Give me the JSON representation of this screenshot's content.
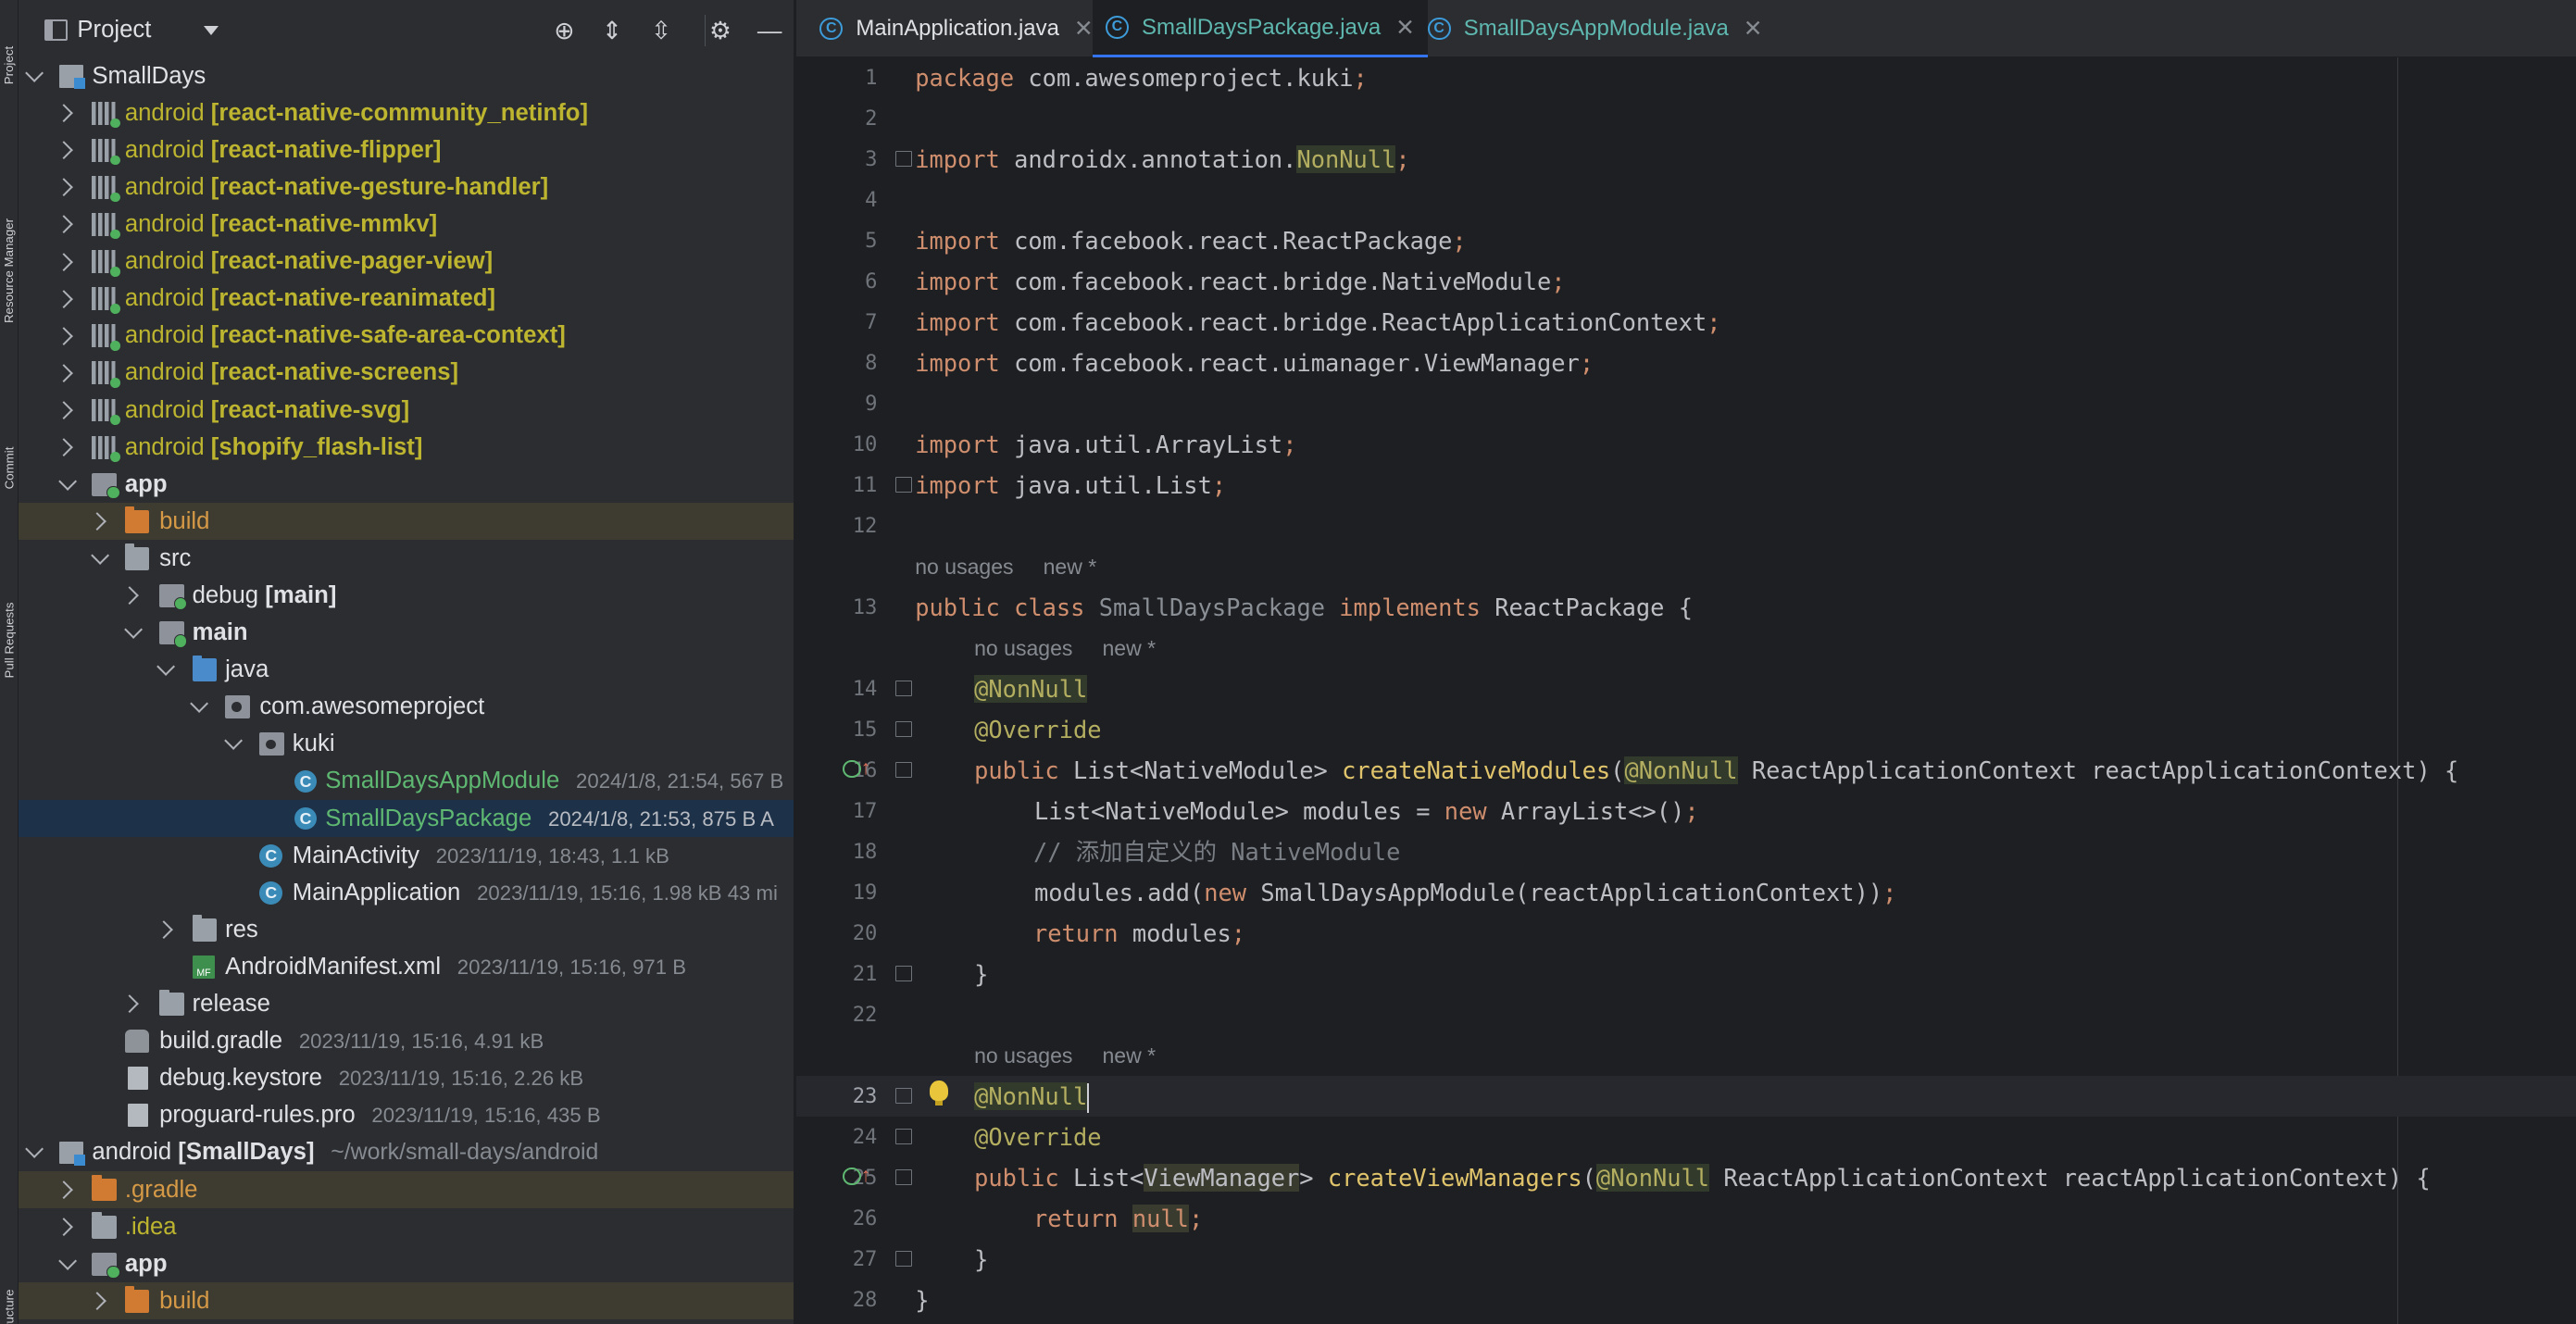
{
  "colors": {
    "accent": "#3574f0",
    "background": "#1e1f22",
    "panel": "#2b2d30",
    "keyword": "#cf8e6d",
    "annotation": "#b3ae60",
    "function": "#56a8f5"
  },
  "side_stripe": [
    "Project",
    "Resource Manager",
    "Commit",
    "Pull Requests",
    "Structure"
  ],
  "project_panel": {
    "title": "Project",
    "toolbar_icons": [
      "locate-icon",
      "expand-all-icon",
      "collapse-all-icon",
      "gear-icon",
      "minimize-icon"
    ]
  },
  "tree": [
    {
      "label": "SmallDays",
      "bracket": "",
      "meta": ""
    },
    {
      "label": "android",
      "bracket": "[react-native-community_netinfo]",
      "meta": ""
    },
    {
      "label": "android",
      "bracket": "[react-native-flipper]",
      "meta": ""
    },
    {
      "label": "android",
      "bracket": "[react-native-gesture-handler]",
      "meta": ""
    },
    {
      "label": "android",
      "bracket": "[react-native-mmkv]",
      "meta": ""
    },
    {
      "label": "android",
      "bracket": "[react-native-pager-view]",
      "meta": ""
    },
    {
      "label": "android",
      "bracket": "[react-native-reanimated]",
      "meta": ""
    },
    {
      "label": "android",
      "bracket": "[react-native-safe-area-context]",
      "meta": ""
    },
    {
      "label": "android",
      "bracket": "[react-native-screens]",
      "meta": ""
    },
    {
      "label": "android",
      "bracket": "[react-native-svg]",
      "meta": ""
    },
    {
      "label": "android",
      "bracket": "[shopify_flash-list]",
      "meta": ""
    },
    {
      "label": "app",
      "bracket": "",
      "meta": ""
    },
    {
      "label": "build",
      "bracket": "",
      "meta": ""
    },
    {
      "label": "src",
      "bracket": "",
      "meta": ""
    },
    {
      "label": "debug",
      "bracket": "[main]",
      "meta": ""
    },
    {
      "label": "main",
      "bracket": "",
      "meta": ""
    },
    {
      "label": "java",
      "bracket": "",
      "meta": ""
    },
    {
      "label": "com.awesomeproject",
      "bracket": "",
      "meta": ""
    },
    {
      "label": "kuki",
      "bracket": "",
      "meta": ""
    },
    {
      "label": "SmallDaysAppModule",
      "bracket": "",
      "meta": "2024/1/8, 21:54, 567 B"
    },
    {
      "label": "SmallDaysPackage",
      "bracket": "",
      "meta": "2024/1/8, 21:53, 875 B A"
    },
    {
      "label": "MainActivity",
      "bracket": "",
      "meta": "2023/11/19, 18:43, 1.1 kB"
    },
    {
      "label": "MainApplication",
      "bracket": "",
      "meta": "2023/11/19, 15:16, 1.98 kB 43 mi"
    },
    {
      "label": "res",
      "bracket": "",
      "meta": ""
    },
    {
      "label": "AndroidManifest.xml",
      "bracket": "",
      "meta": "2023/11/19, 15:16, 971 B"
    },
    {
      "label": "release",
      "bracket": "",
      "meta": ""
    },
    {
      "label": "build.gradle",
      "bracket": "",
      "meta": "2023/11/19, 15:16, 4.91 kB"
    },
    {
      "label": "debug.keystore",
      "bracket": "",
      "meta": "2023/11/19, 15:16, 2.26 kB"
    },
    {
      "label": "proguard-rules.pro",
      "bracket": "",
      "meta": "2023/11/19, 15:16, 435 B"
    },
    {
      "label": "android",
      "bracket": "[SmallDays]",
      "meta": "~/work/small-days/android"
    },
    {
      "label": ".gradle",
      "bracket": "",
      "meta": ""
    },
    {
      "label": ".idea",
      "bracket": "",
      "meta": ""
    },
    {
      "label": "app",
      "bracket": "",
      "meta": ""
    },
    {
      "label": "build",
      "bracket": "",
      "meta": ""
    }
  ],
  "tabs": [
    {
      "icon": "class-icon",
      "label": "MainApplication.java"
    },
    {
      "icon": "class-icon",
      "label": "SmallDaysPackage.java"
    },
    {
      "icon": "class-icon",
      "label": "SmallDaysAppModule.java"
    }
  ],
  "hints": {
    "no_usages": "no usages",
    "new": "new *"
  },
  "line_numbers": [
    "1",
    "2",
    "3",
    "4",
    "5",
    "6",
    "7",
    "8",
    "9",
    "10",
    "11",
    "12",
    "13",
    "14",
    "15",
    "16",
    "17",
    "18",
    "19",
    "20",
    "21",
    "22",
    "23",
    "24",
    "25",
    "26",
    "27",
    "28"
  ],
  "code": {
    "l1": [
      "package",
      " com.awesomeproject.kuki",
      ";"
    ],
    "l3": [
      "import",
      " androidx.annotation.",
      "NonNull",
      ";"
    ],
    "l5": [
      "import",
      " com.facebook.react.ReactPackage",
      ";"
    ],
    "l6": [
      "import",
      " com.facebook.react.bridge.NativeModule",
      ";"
    ],
    "l7": [
      "import",
      " com.facebook.react.bridge.ReactApplicationContext",
      ";"
    ],
    "l8": [
      "import",
      " com.facebook.react.uimanager.ViewManager",
      ";"
    ],
    "l10": [
      "import",
      " java.util.ArrayList",
      ";"
    ],
    "l11": [
      "import",
      " java.util.List",
      ";"
    ],
    "l13": [
      "public class",
      " SmallDaysPackage",
      " implements",
      " ReactPackage {"
    ],
    "l14": "@NonNull",
    "l15": "@Override",
    "l16": [
      "public",
      " List<NativeModule> ",
      "createNativeModules",
      "(",
      "@NonNull",
      " ReactApplicationContext reactApplicationContext) {"
    ],
    "l17": [
      " List<NativeModule> modules = ",
      "new",
      " ArrayList<>()",
      ";"
    ],
    "l18": "// 添加自定义的 NativeModule",
    "l19": [
      " modules.add(",
      "new",
      " SmallDaysAppModule(reactApplicationContext))",
      ";"
    ],
    "l20": [
      "return",
      " modules",
      ";"
    ],
    "l21": "}",
    "l23": "@NonNull",
    "l24": "@Override",
    "l25": [
      "public",
      " List<",
      "ViewManager",
      "> ",
      "createViewManagers",
      "(",
      "@NonNull",
      " ReactApplicationContext reactApplicationContext) {"
    ],
    "l26": [
      "return",
      " ",
      "null",
      ";"
    ],
    "l27": "}",
    "l28": "}"
  }
}
